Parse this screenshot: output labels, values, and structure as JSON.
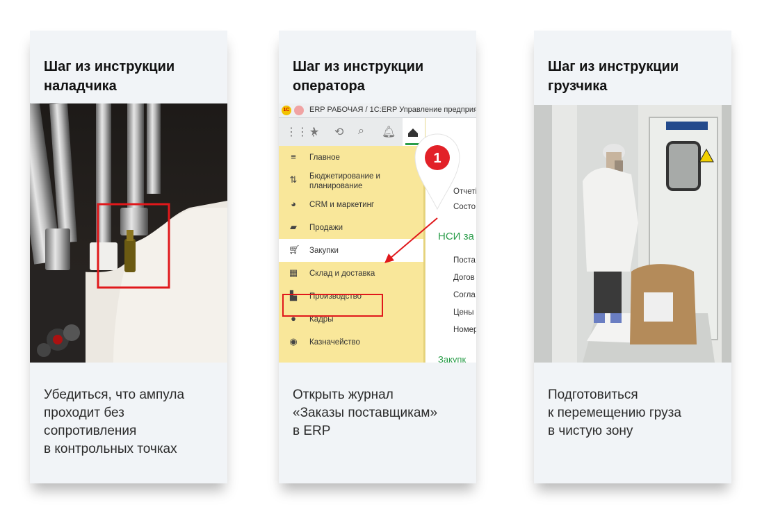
{
  "cards": [
    {
      "title": "Шаг из инструкции\nналадчика",
      "text": "Убедиться, что ампула\nпроходит без\nсопротивления\nв контрольных точках",
      "image": "photo-ampoule-machine"
    },
    {
      "title": "Шаг из инструкции\nоператора",
      "text": "Открыть журнал\n«Заказы поставщикам»\nв ERP",
      "image": "erp-screenshot"
    },
    {
      "title": "Шаг из инструкции\nгрузчика",
      "text": "Подготовиться\nк перемещению груза\nв чистую зону",
      "image": "photo-clean-room-loader"
    }
  ],
  "erp": {
    "logo": "1С",
    "window_title": "ERP РАБОЧАЯ / 1С:ERP Управление предприя",
    "menu": [
      {
        "label": "Главное",
        "icon": "list-icon"
      },
      {
        "label": "Бюджетирование и\nпланирование",
        "icon": "budget-icon"
      },
      {
        "label": "CRM и маркетинг",
        "icon": "pie-icon"
      },
      {
        "label": "Продажи",
        "icon": "bag-icon"
      },
      {
        "label": "Закупки",
        "icon": "cart-icon"
      },
      {
        "label": "Склад и доставка",
        "icon": "warehouse-icon"
      },
      {
        "label": "Производство",
        "icon": "factory-icon"
      },
      {
        "label": "Кадры",
        "icon": "person-icon"
      },
      {
        "label": "Казначейство",
        "icon": "treasury-icon"
      }
    ],
    "right_items": [
      "Отчеті",
      "Состо"
    ],
    "right_head": "НСИ за",
    "right_items2": [
      "Поста",
      "Догов",
      "Согла",
      "Цены",
      "Номер"
    ],
    "right_head2": "Закупк",
    "pin_number": "1"
  },
  "colors": {
    "card_bg": "#f1f4f7",
    "highlight": "#e0181b",
    "sidebar": "#f9e79a",
    "accent_green": "#2a9d4a"
  }
}
